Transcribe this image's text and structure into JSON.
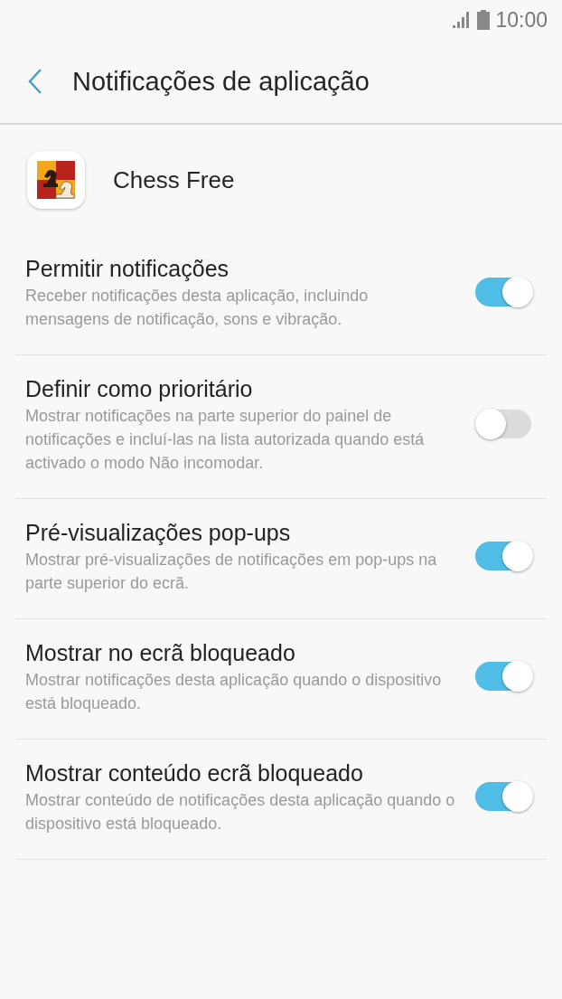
{
  "status_bar": {
    "time": "10:00"
  },
  "header": {
    "title": "Notificações de aplicação"
  },
  "app": {
    "name": "Chess Free"
  },
  "settings": [
    {
      "title": "Permitir notificações",
      "description": "Receber notificações desta aplicação, incluindo mensagens de notificação, sons e vibração.",
      "on": true
    },
    {
      "title": "Definir como prioritário",
      "description": "Mostrar notificações na parte superior do painel de notificações e incluí-las na lista autorizada quando está activado o modo Não incomodar.",
      "on": false
    },
    {
      "title": "Pré-visualizações pop-ups",
      "description": "Mostrar pré-visualizações de notificações em pop-ups na parte superior do ecrã.",
      "on": true
    },
    {
      "title": "Mostrar no ecrã bloqueado",
      "description": "Mostrar notificações desta aplicação quando o dispositivo está bloqueado.",
      "on": true
    },
    {
      "title": "Mostrar conteúdo ecrã bloqueado",
      "description": "Mostrar conteúdo de notificações desta aplicação quando o dispositivo está bloqueado.",
      "on": true
    }
  ]
}
